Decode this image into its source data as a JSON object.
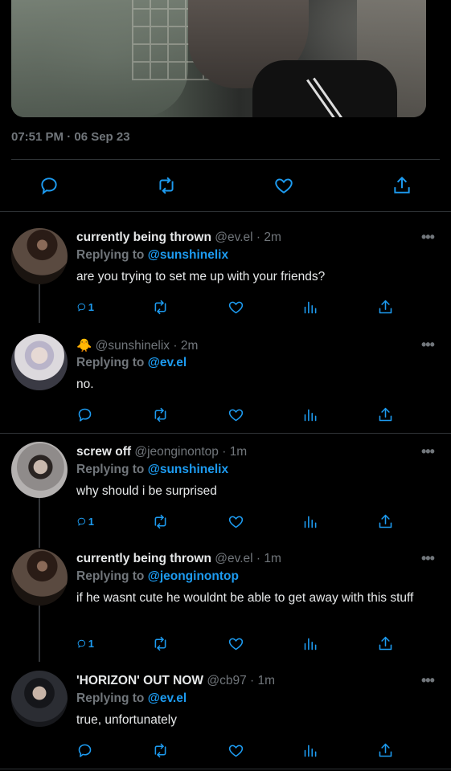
{
  "main_tweet": {
    "timestamp": "07:51 PM · 06 Sep 23"
  },
  "replies": [
    {
      "name": "currently being thrown",
      "handle": "@ev.el",
      "time": "2m",
      "replying_label": "Replying to",
      "replying_to": "@sunshinelix",
      "text": "are you trying to set me up with your friends?",
      "reply_count": "1"
    },
    {
      "name": "🐥",
      "handle": "@sunshinelix",
      "time": "2m",
      "replying_label": "Replying to",
      "replying_to": "@ev.el",
      "text": "no.",
      "reply_count": ""
    },
    {
      "name": "screw off",
      "handle": "@jeonginontop",
      "time": "1m",
      "replying_label": "Replying to",
      "replying_to": "@sunshinelix",
      "text": "why should i be surprised",
      "reply_count": "1"
    },
    {
      "name": "currently being thrown",
      "handle": "@ev.el",
      "time": "1m",
      "replying_label": "Replying to",
      "replying_to": "@jeonginontop",
      "text": "if he wasnt cute he wouldnt be able to get away with this stuff",
      "reply_count": "1"
    },
    {
      "name": "'HORIZON' OUT NOW",
      "handle": "@cb97",
      "time": "1m",
      "replying_label": "Replying to",
      "replying_to": "@ev.el",
      "text": "true, unfortunately",
      "reply_count": ""
    }
  ],
  "separator": "·",
  "more_glyph": "•••",
  "colors": {
    "accent": "#1d9bf0",
    "muted": "#71767b",
    "background": "#000000",
    "text": "#e7e9ea"
  },
  "icons": [
    "reply-icon",
    "retweet-icon",
    "like-icon",
    "views-icon",
    "share-icon",
    "more-icon"
  ]
}
